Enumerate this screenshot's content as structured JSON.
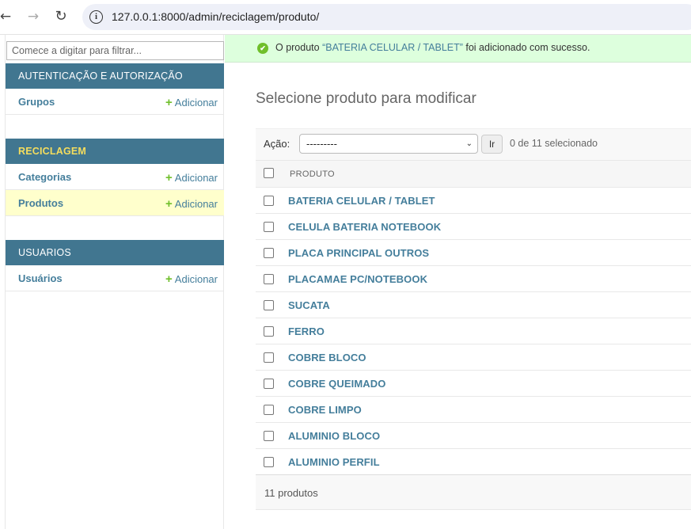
{
  "browser": {
    "back_icon": "←",
    "forward_icon": "→",
    "reload_icon": "↻",
    "url": "127.0.0.1:8000/admin/reciclagem/produto/"
  },
  "sidebar": {
    "filter_placeholder": "Comece a digitar para filtrar...",
    "modules": [
      {
        "title": "AUTENTICAÇÃO E AUTORIZAÇÃO",
        "current": false,
        "models": [
          {
            "label": "Grupos",
            "add_label": "Adicionar",
            "selected": false
          }
        ]
      },
      {
        "title": "RECICLAGEM",
        "current": true,
        "models": [
          {
            "label": "Categorias",
            "add_label": "Adicionar",
            "selected": false
          },
          {
            "label": "Produtos",
            "add_label": "Adicionar",
            "selected": true
          }
        ]
      },
      {
        "title": "USUARIOS",
        "current": false,
        "models": [
          {
            "label": "Usuários",
            "add_label": "Adicionar",
            "selected": false
          }
        ]
      }
    ]
  },
  "message": {
    "prefix": "O produto ",
    "object": "“BATERIA CELULAR / TABLET”",
    "suffix": " foi adicionado com sucesso."
  },
  "page_title": "Selecione produto para modificar",
  "actions": {
    "label": "Ação:",
    "selected_option": "---------",
    "go_label": "Ir",
    "selection_count": "0 de 11 selecionado"
  },
  "table": {
    "column_header": "PRODUTO",
    "rows": [
      "BATERIA CELULAR / TABLET",
      "CELULA BATERIA NOTEBOOK",
      "PLACA PRINCIPAL OUTROS",
      "PLACAMAE PC/NOTEBOOK",
      "SUCATA",
      "FERRO",
      "COBRE BLOCO",
      "COBRE QUEIMADO",
      "COBRE LIMPO",
      "ALUMINIO BLOCO",
      "ALUMINIO PERFIL"
    ]
  },
  "paginator": {
    "text": "11 produtos"
  },
  "colors": {
    "module_header_bg": "#417690",
    "current_module_text": "#f5dd5d",
    "link": "#447e9b",
    "add_icon": "#70bf2b",
    "success_bg": "#ddffdd",
    "selected_row_bg": "#ffffcc"
  }
}
